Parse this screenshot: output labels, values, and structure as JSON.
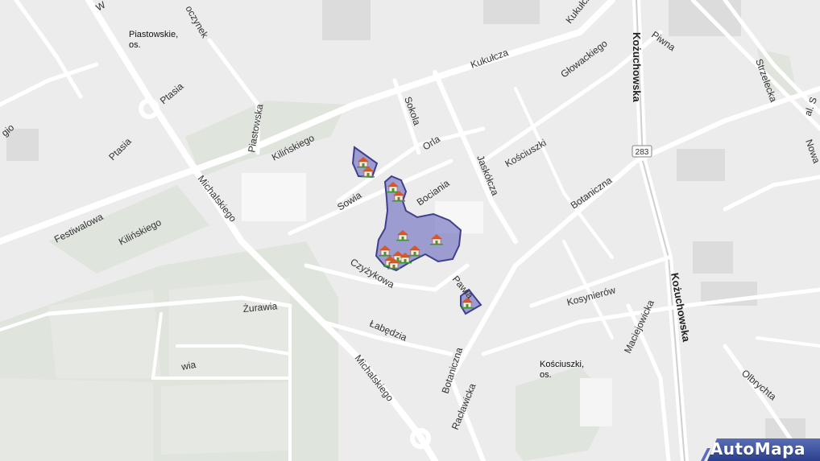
{
  "map": {
    "districts": [
      {
        "id": "piastowskie",
        "line1": "Piastowskie,",
        "line2": "os."
      },
      {
        "id": "kosciuszki",
        "line1": "Kościuszki,",
        "line2": "os."
      }
    ],
    "streets": {
      "kozuchowska_top": "Kożuchowska",
      "kozuchowska_bottom": "Kożuchowska",
      "piwna": "Piwna",
      "strzelecka": "Strzelecka",
      "al_s": "al. S",
      "nowa": "Nowa",
      "kukulcza_a": "Kukułcza",
      "kukulcza_b": "Kukułcza",
      "glowackiego": "Głowackiego",
      "sokola": "Sokola",
      "orla": "Orla",
      "kosciuszki": "Kościuszki",
      "jaskolcza": "Jaskółcza",
      "bociania": "Bociania",
      "sowia": "Sowia",
      "botaniczna_a": "Botaniczna",
      "botaniczna_b": "Botaniczna",
      "czyzykowa": "Czyżykowa",
      "pawia": "Pawia",
      "labedzia": "Łabędzia",
      "kosynierow": "Kosynierów",
      "maciejowicka": "Maciejowicka",
      "olbrychta": "Olbrychta",
      "raclawicka": "Racławicka",
      "michalskiego_a": "Michalskiego",
      "michalskiego_b": "Michalskiego",
      "zurawia": "Żurawia",
      "kilinskiego_a": "Kilińskiego",
      "kilinskiego_b": "Kilińskiego",
      "festiwalowa": "Festiwalowa",
      "ptasia_a": "Ptasia",
      "ptasia_b": "Ptasia",
      "piastowska": "Piastowska",
      "gio": "gio",
      "oczynek": "oczynek",
      "w_top": "W",
      "wia": "wia"
    },
    "road_badge": "283",
    "highlight_color": "#7b7bc4",
    "marker_icon": "house-marker-icon"
  },
  "brand": {
    "name": "AutoMapa"
  }
}
